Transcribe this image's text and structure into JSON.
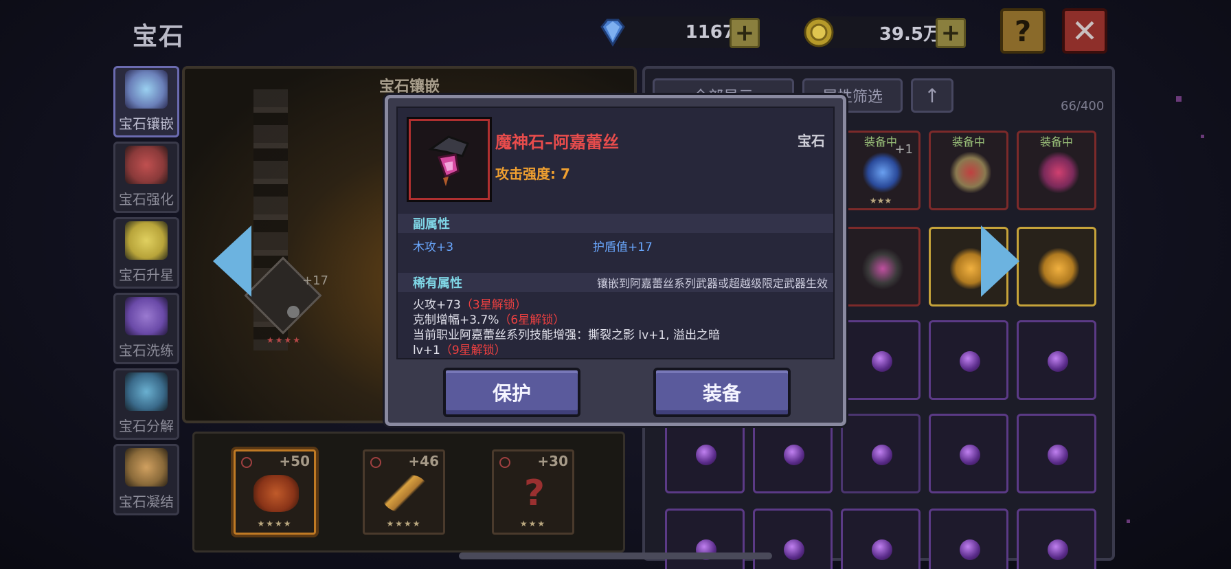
{
  "header": {
    "title": "宝石"
  },
  "currencies": [
    {
      "name": "diamond",
      "value": "1167"
    },
    {
      "name": "gold",
      "value": "39.5万"
    }
  ],
  "buttons": {
    "help": "?",
    "close": "✕",
    "plus": "+"
  },
  "sidebar": {
    "items": [
      {
        "label": "宝石镶嵌",
        "active": true,
        "color": "#6a7fb8"
      },
      {
        "label": "宝石强化",
        "active": false,
        "color": "#8a3a3a"
      },
      {
        "label": "宝石升星",
        "active": false,
        "color": "#b8a43a"
      },
      {
        "label": "宝石洗练",
        "active": false,
        "color": "#6a4aa8"
      },
      {
        "label": "宝石分解",
        "active": false,
        "color": "#3a6a8a"
      },
      {
        "label": "宝石凝结",
        "active": false,
        "color": "#8a6a3a"
      }
    ]
  },
  "center": {
    "panel_title": "宝石镶嵌",
    "socket_level": "+17",
    "socket_stars": "★★★★",
    "tray": [
      {
        "level": "+50",
        "stars": "★★★★",
        "color": "#8a3418"
      },
      {
        "level": "+46",
        "stars": "★★★★",
        "color": "#b07a30"
      },
      {
        "level": "+30",
        "stars": "★★★",
        "color": "#7a2a2a"
      }
    ]
  },
  "inventory": {
    "filters": [
      {
        "label": "全部显示"
      },
      {
        "label": "属性筛选"
      },
      {
        "label": "↑"
      }
    ],
    "count": "66/400",
    "equipped_label": "装备中",
    "slot_plus": "+1",
    "slot_stars": "★★★"
  },
  "modal": {
    "item_name": "魔神石–阿嘉蕾丝",
    "item_type": "宝石",
    "attack": "攻击强度: 7",
    "sub_attr_title": "副属性",
    "sub_attrs": [
      "木攻+3",
      "护盾值+17"
    ],
    "rare_title": "稀有属性",
    "rare_note": "镶嵌到阿嘉蕾丝系列武器或超越级限定武器生效",
    "rare_lines": [
      {
        "text": "火攻+73",
        "lock": "（3星解锁）"
      },
      {
        "text": "克制增幅+3.7%",
        "lock": "（6星解锁）"
      },
      {
        "text": "当前职业阿嘉蕾丝系列技能增强：撕裂之影 lv+1, 溢出之暗",
        "lock": ""
      },
      {
        "text": "lv+1",
        "lock": "（9星解锁）"
      }
    ],
    "buttons": {
      "protect": "保护",
      "equip": "装备"
    }
  }
}
